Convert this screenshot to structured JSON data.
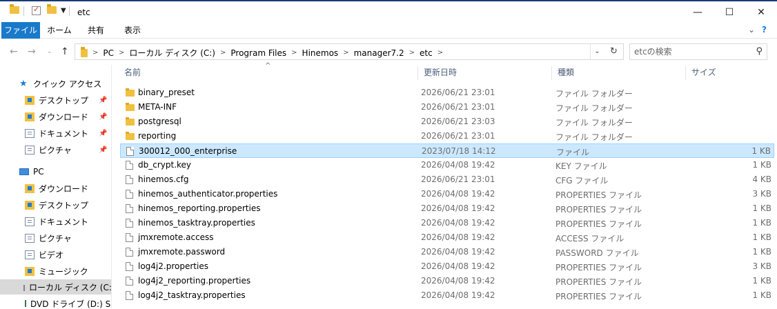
{
  "window": {
    "title": "etc",
    "minimize": "—",
    "maximize": "☐",
    "close": "✕"
  },
  "ribbon": {
    "tabs": [
      "ファイル",
      "ホーム",
      "共有",
      "表示"
    ],
    "collapse": "⌄",
    "help": "?"
  },
  "address": {
    "crumbs": [
      "PC",
      "ローカル ディスク (C:)",
      "Program Files",
      "Hinemos",
      "manager7.2",
      "etc"
    ],
    "search_placeholder": "etcの検索"
  },
  "nav": {
    "quick_access": "クイック アクセス",
    "quick_items": [
      {
        "label": "デスクトップ",
        "icon": "desktop-folder-icon"
      },
      {
        "label": "ダウンロード",
        "icon": "downloads-folder-icon"
      },
      {
        "label": "ドキュメント",
        "icon": "documents-folder-icon"
      },
      {
        "label": "ピクチャ",
        "icon": "pictures-folder-icon"
      }
    ],
    "pc": "PC",
    "pc_items": [
      {
        "label": "ダウンロード",
        "icon": "downloads-folder-icon"
      },
      {
        "label": "デスクトップ",
        "icon": "desktop-folder-icon"
      },
      {
        "label": "ドキュメント",
        "icon": "documents-folder-icon"
      },
      {
        "label": "ピクチャ",
        "icon": "pictures-folder-icon"
      },
      {
        "label": "ビデオ",
        "icon": "videos-folder-icon"
      },
      {
        "label": "ミュージック",
        "icon": "music-folder-icon"
      },
      {
        "label": "ローカル ディスク (C:)",
        "icon": "local-disk-icon"
      },
      {
        "label": "DVD ドライブ (D:) SSS",
        "icon": "dvd-drive-icon"
      }
    ]
  },
  "columns": {
    "name": "名前",
    "date": "更新日時",
    "type": "種類",
    "size": "サイズ"
  },
  "files": [
    {
      "name": "binary_preset",
      "date": "2026/06/21 23:01",
      "type": "ファイル フォルダー",
      "size": "",
      "kind": "folder"
    },
    {
      "name": "META-INF",
      "date": "2026/06/21 23:01",
      "type": "ファイル フォルダー",
      "size": "",
      "kind": "folder"
    },
    {
      "name": "postgresql",
      "date": "2026/06/21 23:03",
      "type": "ファイル フォルダー",
      "size": "",
      "kind": "folder"
    },
    {
      "name": "reporting",
      "date": "2026/06/21 23:01",
      "type": "ファイル フォルダー",
      "size": "",
      "kind": "folder"
    },
    {
      "name": "300012_000_enterprise",
      "date": "2023/07/18 14:12",
      "type": "ファイル",
      "size": "1 KB",
      "kind": "file",
      "selected": true
    },
    {
      "name": "db_crypt.key",
      "date": "2026/04/08 19:42",
      "type": "KEY ファイル",
      "size": "1 KB",
      "kind": "file"
    },
    {
      "name": "hinemos.cfg",
      "date": "2026/06/21 23:01",
      "type": "CFG ファイル",
      "size": "4 KB",
      "kind": "file"
    },
    {
      "name": "hinemos_authenticator.properties",
      "date": "2026/04/08 19:42",
      "type": "PROPERTIES ファイル",
      "size": "3 KB",
      "kind": "file"
    },
    {
      "name": "hinemos_reporting.properties",
      "date": "2026/04/08 19:42",
      "type": "PROPERTIES ファイル",
      "size": "1 KB",
      "kind": "file"
    },
    {
      "name": "hinemos_tasktray.properties",
      "date": "2026/04/08 19:42",
      "type": "PROPERTIES ファイル",
      "size": "1 KB",
      "kind": "file"
    },
    {
      "name": "jmxremote.access",
      "date": "2026/04/08 19:42",
      "type": "ACCESS ファイル",
      "size": "1 KB",
      "kind": "file"
    },
    {
      "name": "jmxremote.password",
      "date": "2026/04/08 19:42",
      "type": "PASSWORD ファイル",
      "size": "1 KB",
      "kind": "file"
    },
    {
      "name": "log4j2.properties",
      "date": "2026/04/08 19:42",
      "type": "PROPERTIES ファイル",
      "size": "3 KB",
      "kind": "file"
    },
    {
      "name": "log4j2_reporting.properties",
      "date": "2026/04/08 19:42",
      "type": "PROPERTIES ファイル",
      "size": "1 KB",
      "kind": "file"
    },
    {
      "name": "log4j2_tasktray.properties",
      "date": "2026/04/08 19:42",
      "type": "PROPERTIES ファイル",
      "size": "1 KB",
      "kind": "file"
    }
  ]
}
